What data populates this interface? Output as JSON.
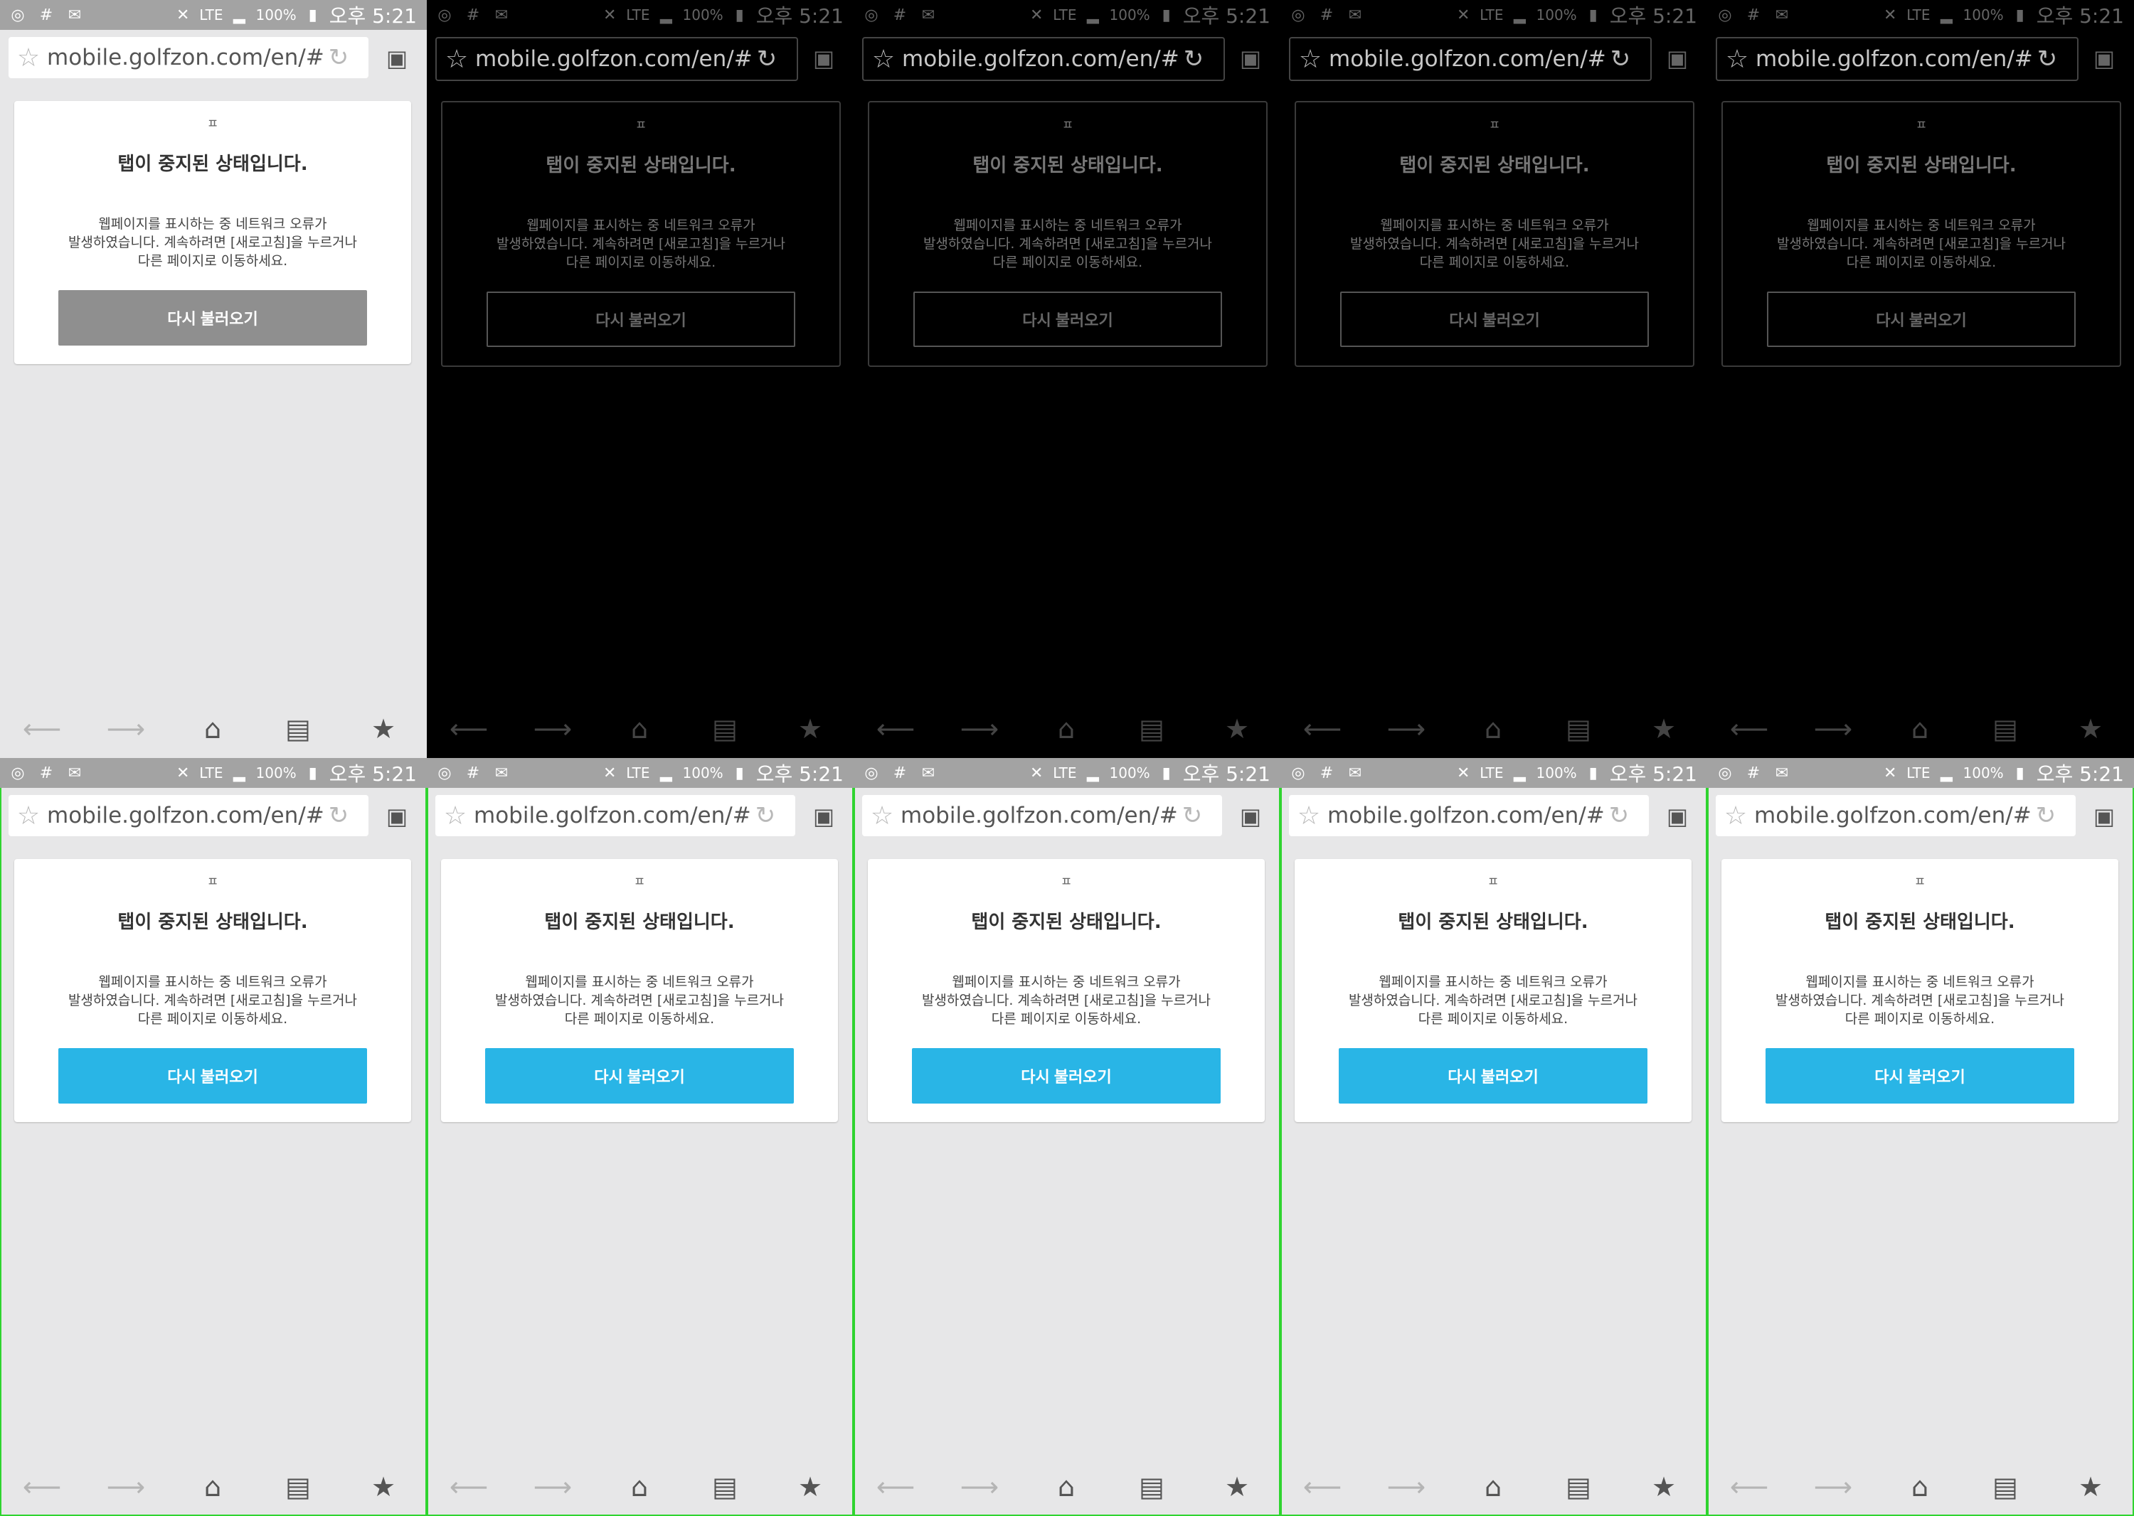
{
  "status_bar": {
    "battery": "100%",
    "network": "LTE",
    "clock": "오후 5:21",
    "left_icons": [
      "browser-icon",
      "hash-icon",
      "mail-icon"
    ],
    "right_icons": [
      "mute-icon",
      "signal-icon",
      "battery-icon"
    ]
  },
  "browser": {
    "url": "mobile.golfzon.com/en/#!/h",
    "star_icon": "star-icon",
    "reload_icon": "reload-icon",
    "tabs_icon": "tabs-icon"
  },
  "error_card": {
    "favicon": "ㅍ",
    "title": "탭이 중지된 상태입니다.",
    "message_line1": "웹페이지를 표시하는 중 네트워크 오류가",
    "message_line2": "발생하였습니다. 계속하려면 [새로고침]을 누르거나",
    "message_line3": "다른 페이지로 이동하세요.",
    "reload_button": "다시 불러오기"
  },
  "bottom_nav": [
    {
      "icon": "back-icon",
      "glyph": "⟵"
    },
    {
      "icon": "forward-icon",
      "glyph": "⟶"
    },
    {
      "icon": "home-icon",
      "glyph": "⌂"
    },
    {
      "icon": "bookmarks-list-icon",
      "glyph": "▤"
    },
    {
      "icon": "bookmark-star-icon",
      "glyph": "★"
    }
  ],
  "colors": {
    "accent_blue": "#29b5e6",
    "highlight_green": "#2fd42f",
    "page_gray": "#e7e7e8"
  }
}
